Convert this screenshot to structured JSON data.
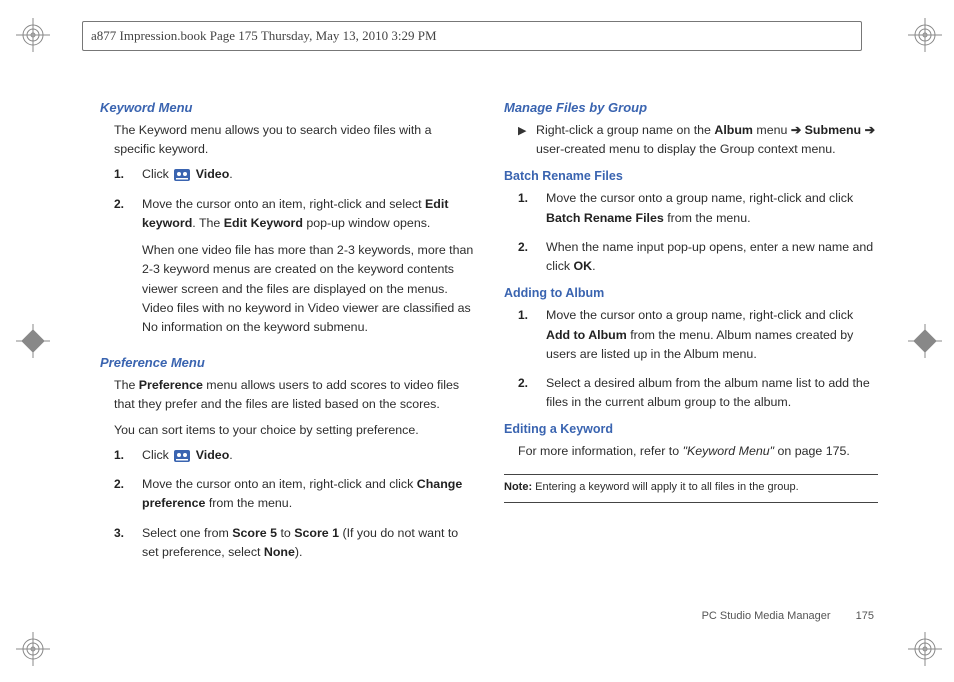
{
  "header": {
    "text": "a877 Impression.book  Page 175  Thursday, May 13, 2010  3:29 PM"
  },
  "left": {
    "keywordMenu": {
      "title": "Keyword Menu",
      "intro": "The Keyword menu allows you to search video files with a specific keyword.",
      "steps": [
        {
          "n": "1.",
          "pre": "Click ",
          "bold": "Video",
          "post": "."
        },
        {
          "n": "2.",
          "line1a": "Move the cursor onto an item, right-click and select ",
          "line1b": "Edit keyword",
          "line1c": ". The ",
          "line1d": "Edit Keyword",
          "line1e": " pop-up window opens.",
          "line2": "When one video file has more than 2-3 keywords, more than 2-3 keyword menus are created on the keyword contents viewer screen and the files are displayed on the menus. Video files with no keyword in Video viewer are classified as No information on the keyword submenu."
        }
      ]
    },
    "preferenceMenu": {
      "title": "Preference Menu",
      "intro1a": "The ",
      "intro1b": "Preference",
      "intro1c": " menu allows users to add scores to video files that they prefer and the files are listed based on the scores.",
      "intro2": "You can sort items to your choice by setting preference.",
      "steps": [
        {
          "n": "1.",
          "pre": "Click ",
          "bold": "Video",
          "post": "."
        },
        {
          "n": "2.",
          "a": "Move the cursor onto an item, right-click and click ",
          "b": "Change preference",
          "c": " from the menu."
        },
        {
          "n": "3.",
          "a": "Select one from ",
          "b": "Score 5",
          "c": " to ",
          "d": "Score 1",
          "e": " (If you do not want to set preference, select ",
          "f": "None",
          "g": ")."
        }
      ]
    }
  },
  "right": {
    "manage": {
      "title": "Manage Files by Group",
      "arrow": {
        "a": "Right-click a group name on the ",
        "b": "Album",
        "c": " menu  ",
        "arr1": "➔",
        "d": " ",
        "e": "Submenu",
        "f": "  ",
        "arr2": "➔",
        "g": " user-created menu to display the Group context menu."
      }
    },
    "batch": {
      "title": "Batch Rename Files",
      "steps": [
        {
          "n": "1.",
          "a": "Move the cursor onto a group name, right-click and click ",
          "b": "Batch Rename Files",
          "c": " from the menu."
        },
        {
          "n": "2.",
          "a": "When the name input pop-up opens, enter a new name and click ",
          "b": "OK",
          "c": "."
        }
      ]
    },
    "addAlbum": {
      "title": "Adding to Album",
      "steps": [
        {
          "n": "1.",
          "a": "Move the cursor onto a group name, right-click and click ",
          "b": "Add to Album",
          "c": " from the menu. Album names created by users are listed up in the Album menu."
        },
        {
          "n": "2.",
          "a": "Select a desired album from the album name list to add the files in the current album group to the album."
        }
      ]
    },
    "editKw": {
      "title": "Editing a Keyword",
      "text": {
        "a": "For more information, refer to ",
        "ref": "\"Keyword Menu\"",
        "b": "  on page 175."
      }
    },
    "note": {
      "label": "Note:",
      "text": " Entering a keyword will apply it to all files in the group."
    }
  },
  "footer": {
    "section": "PC Studio Media Manager",
    "page": "175"
  }
}
